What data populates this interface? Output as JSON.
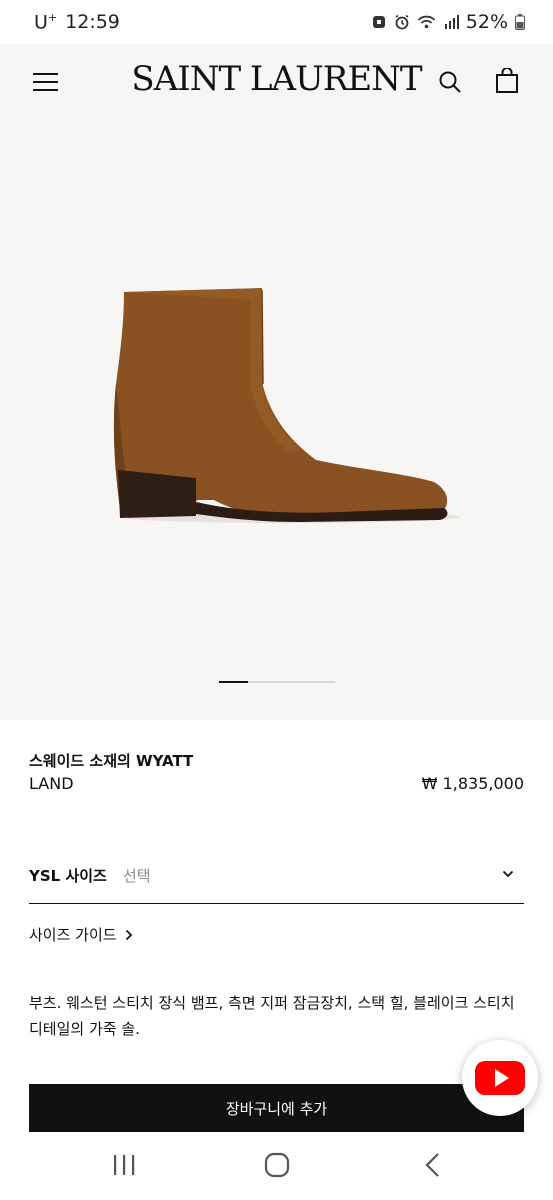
{
  "status_bar": {
    "carrier": "U",
    "carrier_sup": "+",
    "time": "12:59",
    "battery": "52%"
  },
  "header": {
    "logo": "SAINT LAURENT",
    "menu_icon": "hamburger-icon",
    "search_icon": "search-icon",
    "bag_icon": "shopping-bag-icon"
  },
  "gallery": {
    "image": "brown-suede-ankle-boot",
    "page_count": 4,
    "active_page": 1
  },
  "product": {
    "title": "스웨이드 소재의 WYATT",
    "color": "LAND",
    "price": "₩ 1,835,000"
  },
  "size": {
    "label": "YSL 사이즈",
    "select_placeholder": "선택"
  },
  "size_guide": {
    "label": "사이즈 가이드"
  },
  "description": "부츠. 웨스턴 스티치 장식 뱀프, 측면 지퍼 잠금장치, 스택 힐, 블레이크 스티치 디테일의 가죽 솔.",
  "cta": {
    "add_to_cart": "장바구니에 추가"
  },
  "floating": {
    "icon": "youtube-icon",
    "color": "#ff0000"
  },
  "colors": {
    "gallery_bg": "#f7f6f4",
    "boot": "#8a5222",
    "button_bg": "#111111"
  }
}
